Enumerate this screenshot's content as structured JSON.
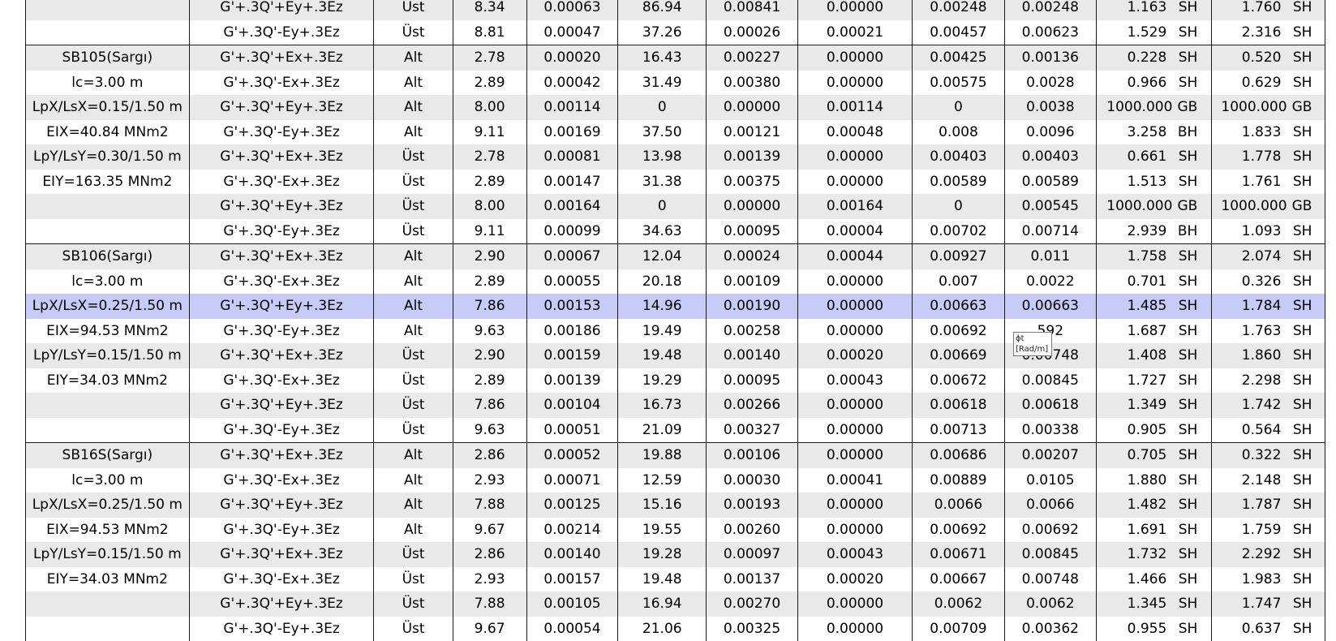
{
  "rows": [
    {
      "elem": "",
      "combo": "G'+.3Q'+Ey+.3Ez",
      "face": "Üst",
      "v1": "8.34",
      "v2": "0.00063",
      "v3": "86.94",
      "v4": "0.00841",
      "v5": "0.00000",
      "v6": "0.00248",
      "v7": "0.00248",
      "r1": "1.163",
      "m1": "SH",
      "r2": "1.760",
      "m2": "SH",
      "shade": true,
      "group_start": false,
      "selected": false
    },
    {
      "elem": "",
      "combo": "G'+.3Q'-Ey+.3Ez",
      "face": "Üst",
      "v1": "8.81",
      "v2": "0.00047",
      "v3": "37.26",
      "v4": "0.00026",
      "v5": "0.00021",
      "v6": "0.00457",
      "v7": "0.00623",
      "r1": "1.529",
      "m1": "SH",
      "r2": "2.316",
      "m2": "SH",
      "shade": false,
      "group_start": false,
      "selected": false
    },
    {
      "elem": "SB105(Sargı)",
      "combo": "G'+.3Q'+Ex+.3Ez",
      "face": "Alt",
      "v1": "2.78",
      "v2": "0.00020",
      "v3": "16.43",
      "v4": "0.00227",
      "v5": "0.00000",
      "v6": "0.00425",
      "v7": "0.00136",
      "r1": "0.228",
      "m1": "SH",
      "r2": "0.520",
      "m2": "SH",
      "shade": true,
      "group_start": true,
      "selected": false
    },
    {
      "elem": "lc=3.00 m",
      "combo": "G'+.3Q'-Ex+.3Ez",
      "face": "Alt",
      "v1": "2.89",
      "v2": "0.00042",
      "v3": "31.49",
      "v4": "0.00380",
      "v5": "0.00000",
      "v6": "0.00575",
      "v7": "0.0028",
      "r1": "0.966",
      "m1": "SH",
      "r2": "0.629",
      "m2": "SH",
      "shade": false,
      "group_start": false,
      "selected": false
    },
    {
      "elem": "LpX/LsX=0.15/1.50 m",
      "combo": "G'+.3Q'+Ey+.3Ez",
      "face": "Alt",
      "v1": "8.00",
      "v2": "0.00114",
      "v3": "0",
      "v4": "0.00000",
      "v5": "0.00114",
      "v6": "0",
      "v7": "0.0038",
      "r1": "1000.000",
      "m1": "GB",
      "r2": "1000.000",
      "m2": "GB",
      "shade": true,
      "group_start": false,
      "selected": false
    },
    {
      "elem": "EIX=40.84 MNm2",
      "combo": "G'+.3Q'-Ey+.3Ez",
      "face": "Alt",
      "v1": "9.11",
      "v2": "0.00169",
      "v3": "37.50",
      "v4": "0.00121",
      "v5": "0.00048",
      "v6": "0.008",
      "v7": "0.0096",
      "r1": "3.258",
      "m1": "BH",
      "r2": "1.833",
      "m2": "SH",
      "shade": false,
      "group_start": false,
      "selected": false
    },
    {
      "elem": "LpY/LsY=0.30/1.50 m",
      "combo": "G'+.3Q'+Ex+.3Ez",
      "face": "Üst",
      "v1": "2.78",
      "v2": "0.00081",
      "v3": "13.98",
      "v4": "0.00139",
      "v5": "0.00000",
      "v6": "0.00403",
      "v7": "0.00403",
      "r1": "0.661",
      "m1": "SH",
      "r2": "1.778",
      "m2": "SH",
      "shade": true,
      "group_start": false,
      "selected": false
    },
    {
      "elem": "EIY=163.35 MNm2",
      "combo": "G'+.3Q'-Ex+.3Ez",
      "face": "Üst",
      "v1": "2.89",
      "v2": "0.00147",
      "v3": "31.38",
      "v4": "0.00375",
      "v5": "0.00000",
      "v6": "0.00589",
      "v7": "0.00589",
      "r1": "1.513",
      "m1": "SH",
      "r2": "1.761",
      "m2": "SH",
      "shade": false,
      "group_start": false,
      "selected": false
    },
    {
      "elem": "",
      "combo": "G'+.3Q'+Ey+.3Ez",
      "face": "Üst",
      "v1": "8.00",
      "v2": "0.00164",
      "v3": "0",
      "v4": "0.00000",
      "v5": "0.00164",
      "v6": "0",
      "v7": "0.00545",
      "r1": "1000.000",
      "m1": "GB",
      "r2": "1000.000",
      "m2": "GB",
      "shade": true,
      "group_start": false,
      "selected": false
    },
    {
      "elem": "",
      "combo": "G'+.3Q'-Ey+.3Ez",
      "face": "Üst",
      "v1": "9.11",
      "v2": "0.00099",
      "v3": "34.63",
      "v4": "0.00095",
      "v5": "0.00004",
      "v6": "0.00702",
      "v7": "0.00714",
      "r1": "2.939",
      "m1": "BH",
      "r2": "1.093",
      "m2": "SH",
      "shade": false,
      "group_start": false,
      "selected": false
    },
    {
      "elem": "SB106(Sargı)",
      "combo": "G'+.3Q'+Ex+.3Ez",
      "face": "Alt",
      "v1": "2.90",
      "v2": "0.00067",
      "v3": "12.04",
      "v4": "0.00024",
      "v5": "0.00044",
      "v6": "0.00927",
      "v7": "0.011",
      "r1": "1.758",
      "m1": "SH",
      "r2": "2.074",
      "m2": "SH",
      "shade": true,
      "group_start": true,
      "selected": false
    },
    {
      "elem": "lc=3.00 m",
      "combo": "G'+.3Q'-Ex+.3Ez",
      "face": "Alt",
      "v1": "2.89",
      "v2": "0.00055",
      "v3": "20.18",
      "v4": "0.00109",
      "v5": "0.00000",
      "v6": "0.007",
      "v7": "0.0022",
      "r1": "0.701",
      "m1": "SH",
      "r2": "0.326",
      "m2": "SH",
      "shade": false,
      "group_start": false,
      "selected": false
    },
    {
      "elem": "LpX/LsX=0.25/1.50 m",
      "combo": "G'+.3Q'+Ey+.3Ez",
      "face": "Alt",
      "v1": "7.86",
      "v2": "0.00153",
      "v3": "14.96",
      "v4": "0.00190",
      "v5": "0.00000",
      "v6": "0.00663",
      "v7": "0.00663",
      "r1": "1.485",
      "m1": "SH",
      "r2": "1.784",
      "m2": "SH",
      "shade": false,
      "group_start": false,
      "selected": true
    },
    {
      "elem": "EIX=94.53 MNm2",
      "combo": "G'+.3Q'-Ey+.3Ez",
      "face": "Alt",
      "v1": "9.63",
      "v2": "0.00186",
      "v3": "19.49",
      "v4": "0.00258",
      "v5": "0.00000",
      "v6": "0.00692",
      "v7": "592",
      "r1": "1.687",
      "m1": "SH",
      "r2": "1.763",
      "m2": "SH",
      "shade": false,
      "group_start": false,
      "selected": false
    },
    {
      "elem": "LpY/LsY=0.15/1.50 m",
      "combo": "G'+.3Q'+Ex+.3Ez",
      "face": "Üst",
      "v1": "2.90",
      "v2": "0.00159",
      "v3": "19.48",
      "v4": "0.00140",
      "v5": "0.00020",
      "v6": "0.00669",
      "v7": "0.00748",
      "r1": "1.408",
      "m1": "SH",
      "r2": "1.860",
      "m2": "SH",
      "shade": true,
      "group_start": false,
      "selected": false
    },
    {
      "elem": "EIY=34.03 MNm2",
      "combo": "G'+.3Q'-Ex+.3Ez",
      "face": "Üst",
      "v1": "2.89",
      "v2": "0.00139",
      "v3": "19.29",
      "v4": "0.00095",
      "v5": "0.00043",
      "v6": "0.00672",
      "v7": "0.00845",
      "r1": "1.727",
      "m1": "SH",
      "r2": "2.298",
      "m2": "SH",
      "shade": false,
      "group_start": false,
      "selected": false
    },
    {
      "elem": "",
      "combo": "G'+.3Q'+Ey+.3Ez",
      "face": "Üst",
      "v1": "7.86",
      "v2": "0.00104",
      "v3": "16.73",
      "v4": "0.00266",
      "v5": "0.00000",
      "v6": "0.00618",
      "v7": "0.00618",
      "r1": "1.349",
      "m1": "SH",
      "r2": "1.742",
      "m2": "SH",
      "shade": true,
      "group_start": false,
      "selected": false
    },
    {
      "elem": "",
      "combo": "G'+.3Q'-Ey+.3Ez",
      "face": "Üst",
      "v1": "9.63",
      "v2": "0.00051",
      "v3": "21.09",
      "v4": "0.00327",
      "v5": "0.00000",
      "v6": "0.00713",
      "v7": "0.00338",
      "r1": "0.905",
      "m1": "SH",
      "r2": "0.564",
      "m2": "SH",
      "shade": false,
      "group_start": false,
      "selected": false
    },
    {
      "elem": "SB16S(Sargı)",
      "combo": "G'+.3Q'+Ex+.3Ez",
      "face": "Alt",
      "v1": "2.86",
      "v2": "0.00052",
      "v3": "19.88",
      "v4": "0.00106",
      "v5": "0.00000",
      "v6": "0.00686",
      "v7": "0.00207",
      "r1": "0.705",
      "m1": "SH",
      "r2": "0.322",
      "m2": "SH",
      "shade": true,
      "group_start": true,
      "selected": false
    },
    {
      "elem": "lc=3.00 m",
      "combo": "G'+.3Q'-Ex+.3Ez",
      "face": "Alt",
      "v1": "2.93",
      "v2": "0.00071",
      "v3": "12.59",
      "v4": "0.00030",
      "v5": "0.00041",
      "v6": "0.00889",
      "v7": "0.0105",
      "r1": "1.880",
      "m1": "SH",
      "r2": "2.148",
      "m2": "SH",
      "shade": false,
      "group_start": false,
      "selected": false
    },
    {
      "elem": "LpX/LsX=0.25/1.50 m",
      "combo": "G'+.3Q'+Ey+.3Ez",
      "face": "Alt",
      "v1": "7.88",
      "v2": "0.00125",
      "v3": "15.16",
      "v4": "0.00193",
      "v5": "0.00000",
      "v6": "0.0066",
      "v7": "0.0066",
      "r1": "1.482",
      "m1": "SH",
      "r2": "1.787",
      "m2": "SH",
      "shade": true,
      "group_start": false,
      "selected": false
    },
    {
      "elem": "EIX=94.53 MNm2",
      "combo": "G'+.3Q'-Ey+.3Ez",
      "face": "Alt",
      "v1": "9.67",
      "v2": "0.00214",
      "v3": "19.55",
      "v4": "0.00260",
      "v5": "0.00000",
      "v6": "0.00692",
      "v7": "0.00692",
      "r1": "1.691",
      "m1": "SH",
      "r2": "1.759",
      "m2": "SH",
      "shade": false,
      "group_start": false,
      "selected": false
    },
    {
      "elem": "LpY/LsY=0.15/1.50 m",
      "combo": "G'+.3Q'+Ex+.3Ez",
      "face": "Üst",
      "v1": "2.86",
      "v2": "0.00140",
      "v3": "19.28",
      "v4": "0.00097",
      "v5": "0.00043",
      "v6": "0.00671",
      "v7": "0.00845",
      "r1": "1.732",
      "m1": "SH",
      "r2": "2.292",
      "m2": "SH",
      "shade": true,
      "group_start": false,
      "selected": false
    },
    {
      "elem": "EIY=34.03 MNm2",
      "combo": "G'+.3Q'-Ex+.3Ez",
      "face": "Üst",
      "v1": "2.93",
      "v2": "0.00157",
      "v3": "19.48",
      "v4": "0.00137",
      "v5": "0.00020",
      "v6": "0.00667",
      "v7": "0.00748",
      "r1": "1.466",
      "m1": "SH",
      "r2": "1.983",
      "m2": "SH",
      "shade": false,
      "group_start": false,
      "selected": false
    },
    {
      "elem": "",
      "combo": "G'+.3Q'+Ey+.3Ez",
      "face": "Üst",
      "v1": "7.88",
      "v2": "0.00105",
      "v3": "16.94",
      "v4": "0.00270",
      "v5": "0.00000",
      "v6": "0.0062",
      "v7": "0.0062",
      "r1": "1.345",
      "m1": "SH",
      "r2": "1.747",
      "m2": "SH",
      "shade": true,
      "group_start": false,
      "selected": false
    },
    {
      "elem": "",
      "combo": "G'+.3Q'-Ey+.3Ez",
      "face": "Üst",
      "v1": "9.67",
      "v2": "0.00054",
      "v3": "21.06",
      "v4": "0.00325",
      "v5": "0.00000",
      "v6": "0.00709",
      "v7": "0.00362",
      "r1": "0.955",
      "m1": "SH",
      "r2": "0.637",
      "m2": "SH",
      "shade": false,
      "group_start": false,
      "selected": false
    }
  ],
  "tooltip": {
    "line1": "ɸt",
    "line2": "[Rad/m]"
  }
}
